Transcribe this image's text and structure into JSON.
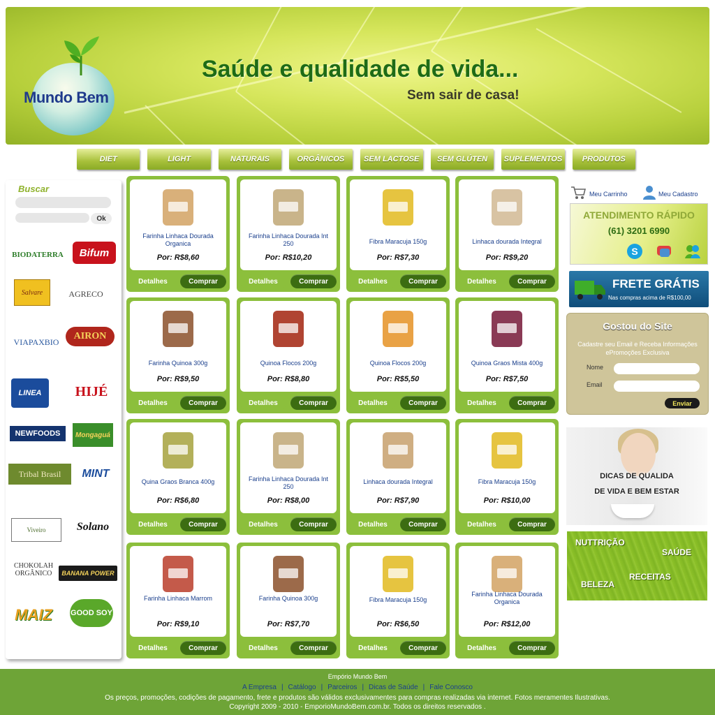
{
  "header": {
    "logo_text": "Mundo Bem",
    "headline": "Saúde e qualidade de vida...",
    "subline": "Sem sair de casa!"
  },
  "nav": [
    "DIET",
    "LIGHT",
    "NATURAIS",
    "ORGÂNICOS",
    "SEM LACTOSE",
    "SEM GLÚTEN",
    "SUPLEMENTOS",
    "PRODUTOS"
  ],
  "sidebar": {
    "search_label": "Buscar",
    "ok_label": "Ok",
    "brands": [
      "BIODATERRA",
      "Bifum",
      "Salvare",
      "AGRECO",
      "VIAPAXBIO",
      "AIRON",
      "LINEA",
      "HIJÉ",
      "NEWFOODS",
      "Mongaguá",
      "Tribal Brasil",
      "MINT",
      "Viveiro",
      "Solano",
      "CHOKOLAH ORGÂNICO",
      "BANANA POWER",
      "MAIZ",
      "GOOD SOY"
    ]
  },
  "products": [
    {
      "name": "Farinha Linhaca Dourada Organica",
      "price": "Por: R$8,60",
      "color": "#d9b07a"
    },
    {
      "name": "Farinha Linhaca Dourada Int 250",
      "price": "Por: R$10,20",
      "color": "#c9b48a"
    },
    {
      "name": "Fibra Maracuja 150g",
      "price": "Por: R$7,30",
      "color": "#e6c440"
    },
    {
      "name": "Linhaca dourada Integral",
      "price": "Por: R$9,20",
      "color": "#d8c3a3"
    },
    {
      "name": "Farinha Quinoa 300g",
      "price": "Por: R$9,50",
      "color": "#9c6a4a"
    },
    {
      "name": "Quinoa Flocos 200g",
      "price": "Por: R$8,80",
      "color": "#b04432"
    },
    {
      "name": "Quinoa Flocos 200g",
      "price": "Por: R$5,50",
      "color": "#e9a245"
    },
    {
      "name": "Quinoa Graos Mista 400g",
      "price": "Por: R$7,50",
      "color": "#8a3a55"
    },
    {
      "name": "Quina Graos Branca 400g",
      "price": "Por: R$6,80",
      "color": "#b3b05a"
    },
    {
      "name": "Farinha Linhaca Dourada Int 250",
      "price": "Por: R$8,00",
      "color": "#c9b48a"
    },
    {
      "name": "Linhaca dourada Integral",
      "price": "Por: R$7,90",
      "color": "#cfae82"
    },
    {
      "name": "Fibra Maracuja 150g",
      "price": "Por: R$10,00",
      "color": "#e6c440"
    },
    {
      "name": "Farinha Linhaca Marrom",
      "price": "Por: R$9,10",
      "color": "#c45a4a"
    },
    {
      "name": "Farinha Quinoa 300g",
      "price": "Por: R$7,70",
      "color": "#9c6a4a"
    },
    {
      "name": "Fibra Maracuja 150g",
      "price": "Por: R$6,50",
      "color": "#e6c440"
    },
    {
      "name": "Farinha Linhaca Dourada Organica",
      "price": "Por: R$12,00",
      "color": "#d9b07a"
    }
  ],
  "buttons": {
    "details": "Detalhes",
    "buy": "Comprar"
  },
  "right": {
    "cart_label": "Meu Carrinho",
    "account_label": "Meu Cadastro",
    "atendimento_title": "ATENDIMENTO RÁPIDO",
    "phone": "(61) 3201 6990",
    "frete_title": "FRETE GRÁTIS",
    "frete_sub": "Nas compras acima de R$100,00",
    "gostou_title": "Gostou do Site",
    "gostou_text": "Cadastre seu Email  e Receba Informações ePromoções Exclusiva",
    "nome_label": "Nome",
    "email_label": "Email",
    "enviar_label": "Enviar",
    "dicas_line1": "DICAS DE QUALIDA",
    "dicas_line2": "DE VIDA E BEM ESTAR",
    "nutricao": "NUTTRIÇÃO",
    "saude": "SAÚDE",
    "beleza": "BELEZA",
    "receitas": "RECEITAS"
  },
  "footer": {
    "company": "Empório Mundo Bem",
    "links": [
      "A Empresa",
      "Catálogo",
      "Parceiros",
      "Dicas de Saúde",
      "Fale Conosco"
    ],
    "disclaimer": "Os preços, promoções, codições de pagamento, frete e produtos são válidos exclusivamentes para compras realizadas via internet. Fotos meramentes  Ilustrativas.",
    "copyright": "Copyright  2009 - 2010 - EmporioMundoBem.com.br. Todos os direitos reservados ."
  }
}
